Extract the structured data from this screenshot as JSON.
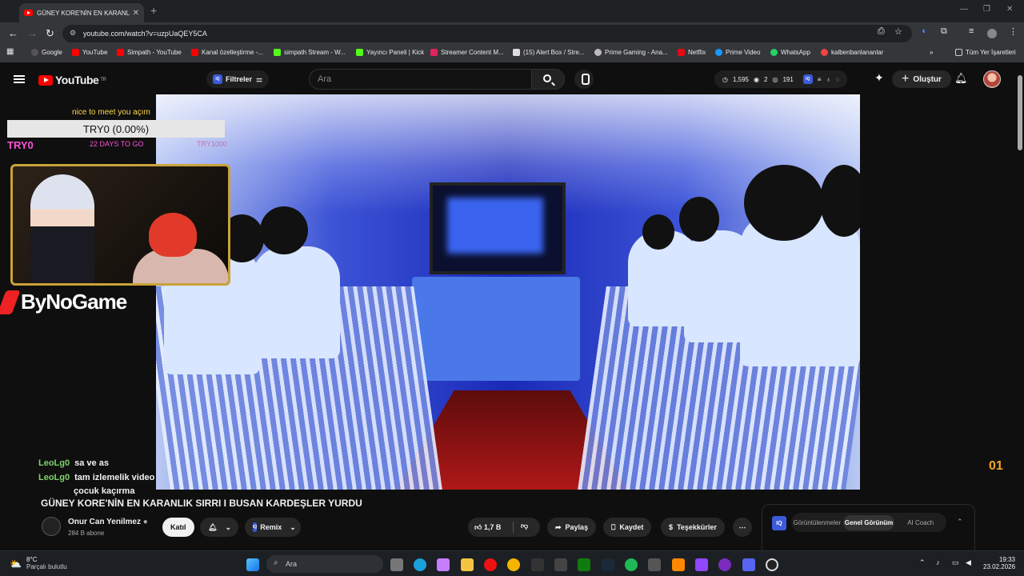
{
  "browser": {
    "tab_title": "GÜNEY KORE'NİN EN KARANLI",
    "url": "youtube.com/watch?v=uzpUaQEY5CA",
    "all_bookmarks": "Tüm Yer İşaretleri"
  },
  "bookmarks": [
    "Google",
    "YouTube",
    "Simpath - YouTube",
    "Kanal özelleştirme -...",
    "simpath Stream - W...",
    "Yayıncı Paneli | Kick",
    "Streamer Content M...",
    "(15) Alert Box / Stre...",
    "Prime Gaming - Ana...",
    "Netflix",
    "Prime Video",
    "WhatsApp",
    "kalbenbanlananlar"
  ],
  "youtube": {
    "logo": "YouTube",
    "region": "TR",
    "filters": "Filtreler",
    "search_placeholder": "Ara",
    "stats": {
      "a": "1,595",
      "b": "2",
      "c": "191"
    },
    "create": "Oluştur"
  },
  "overlay": {
    "greeting": "nice to meet you açım",
    "goal": "TRY0 (0.00%)",
    "goal_left": "TRY0",
    "goal_days": "22 DAYS TO GO",
    "goal_target": "TRY1000",
    "brand": "ByNoGame",
    "chat": [
      {
        "user": "LeoLg0",
        "msg": "sa ve as"
      },
      {
        "user": "LeoLg0",
        "msg": "tam izlemelik video"
      },
      {
        "user": "",
        "msg": "çocuk kaçırma"
      }
    ],
    "corner": "01"
  },
  "video": {
    "title": "GÜNEY KORE'NİN EN KARANLIK SIRRI I BUSAN KARDEŞLER YURDU",
    "channel": "Onur Can Yenilmez",
    "subscribers": "284 B abone",
    "join": "Katıl",
    "remix": "Remix",
    "likes": "1,7 B",
    "share": "Paylaş",
    "save": "Kaydet",
    "thanks": "Teşekkürler"
  },
  "ai_panel": {
    "tabs": [
      "Görüntülenmeler",
      "Genel Görünüm",
      "AI Coach"
    ],
    "active_tab": "Genel Görünüm"
  },
  "taskbar": {
    "temp": "8°C",
    "weather": "Parçalı bulutlu",
    "search": "Ara",
    "time": "19:33",
    "date": "23.02.2026"
  }
}
